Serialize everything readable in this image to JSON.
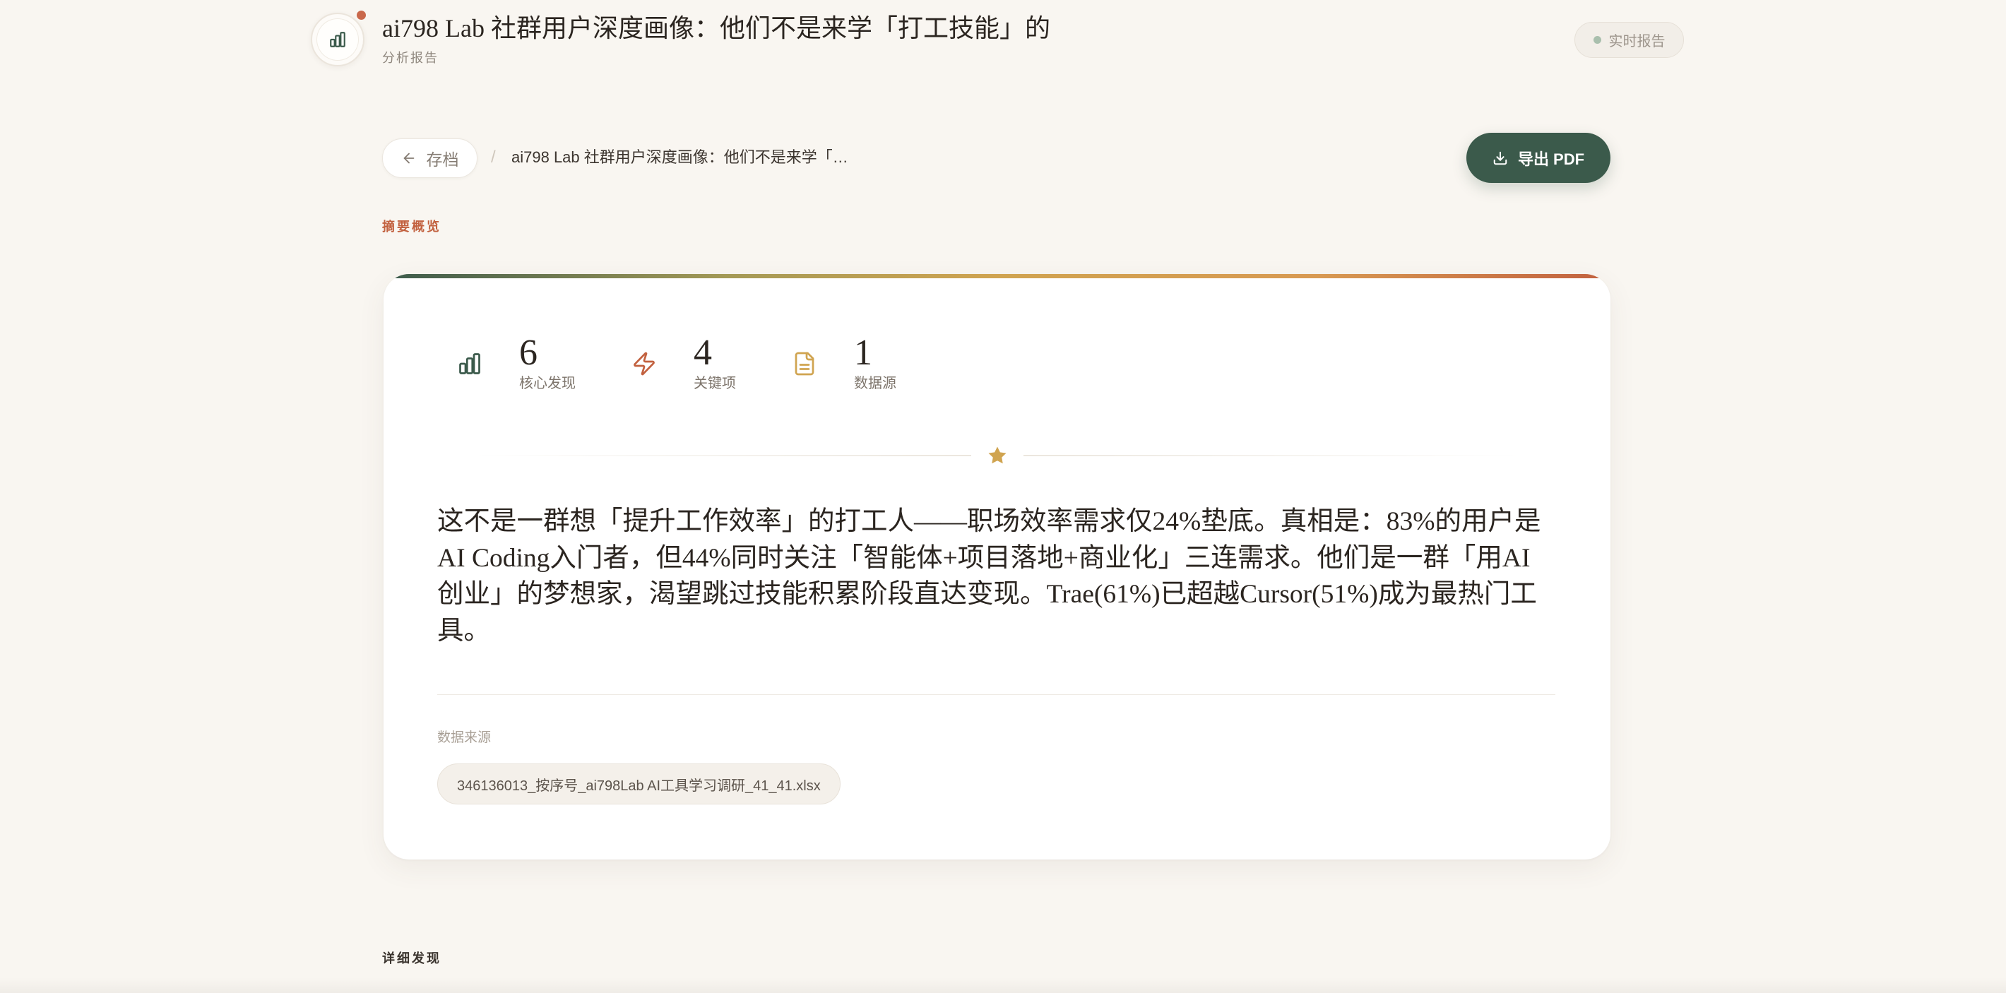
{
  "theme": {
    "primary": "#3b5a4b",
    "accent": "#c2613f",
    "gold": "#d0a450",
    "background": "#f9f6f1"
  },
  "header": {
    "logo_icon": "bar-chart-icon",
    "title": "ai798 Lab 社群用户深度画像：他们不是来学「打工技能」的",
    "subtitle": "分析报告",
    "status_label": "实时报告"
  },
  "toolbar": {
    "back_icon": "arrow-left-icon",
    "back_label": "存档",
    "separator": "/",
    "breadcrumb_current": "ai798 Lab 社群用户深度画像：他们不是来学「…",
    "export_icon": "download-icon",
    "export_label": "导出 PDF"
  },
  "summary": {
    "section_label": "摘要概览",
    "stats": [
      {
        "icon": "bar-chart-icon",
        "value": 6,
        "label": "核心发现"
      },
      {
        "icon": "zap-icon",
        "value": 4,
        "label": "关键项"
      },
      {
        "icon": "file-text-icon",
        "value": 1,
        "label": "数据源"
      }
    ],
    "divider_icon": "star-icon",
    "text": "这不是一群想「提升工作效率」的打工人——职场效率需求仅24%垫底。真相是：83%的用户是AI Coding入门者，但44%同时关注「智能体+项目落地+商业化」三连需求。他们是一群「用AI创业」的梦想家，渴望跳过技能积累阶段直达变现。Trae(61%)已超越Cursor(51%)成为最热门工具。",
    "sources_label": "数据来源",
    "sources": [
      "346136013_按序号_ai798Lab AI工具学习调研_41_41.xlsx"
    ]
  },
  "details": {
    "section_label": "详细发现"
  }
}
